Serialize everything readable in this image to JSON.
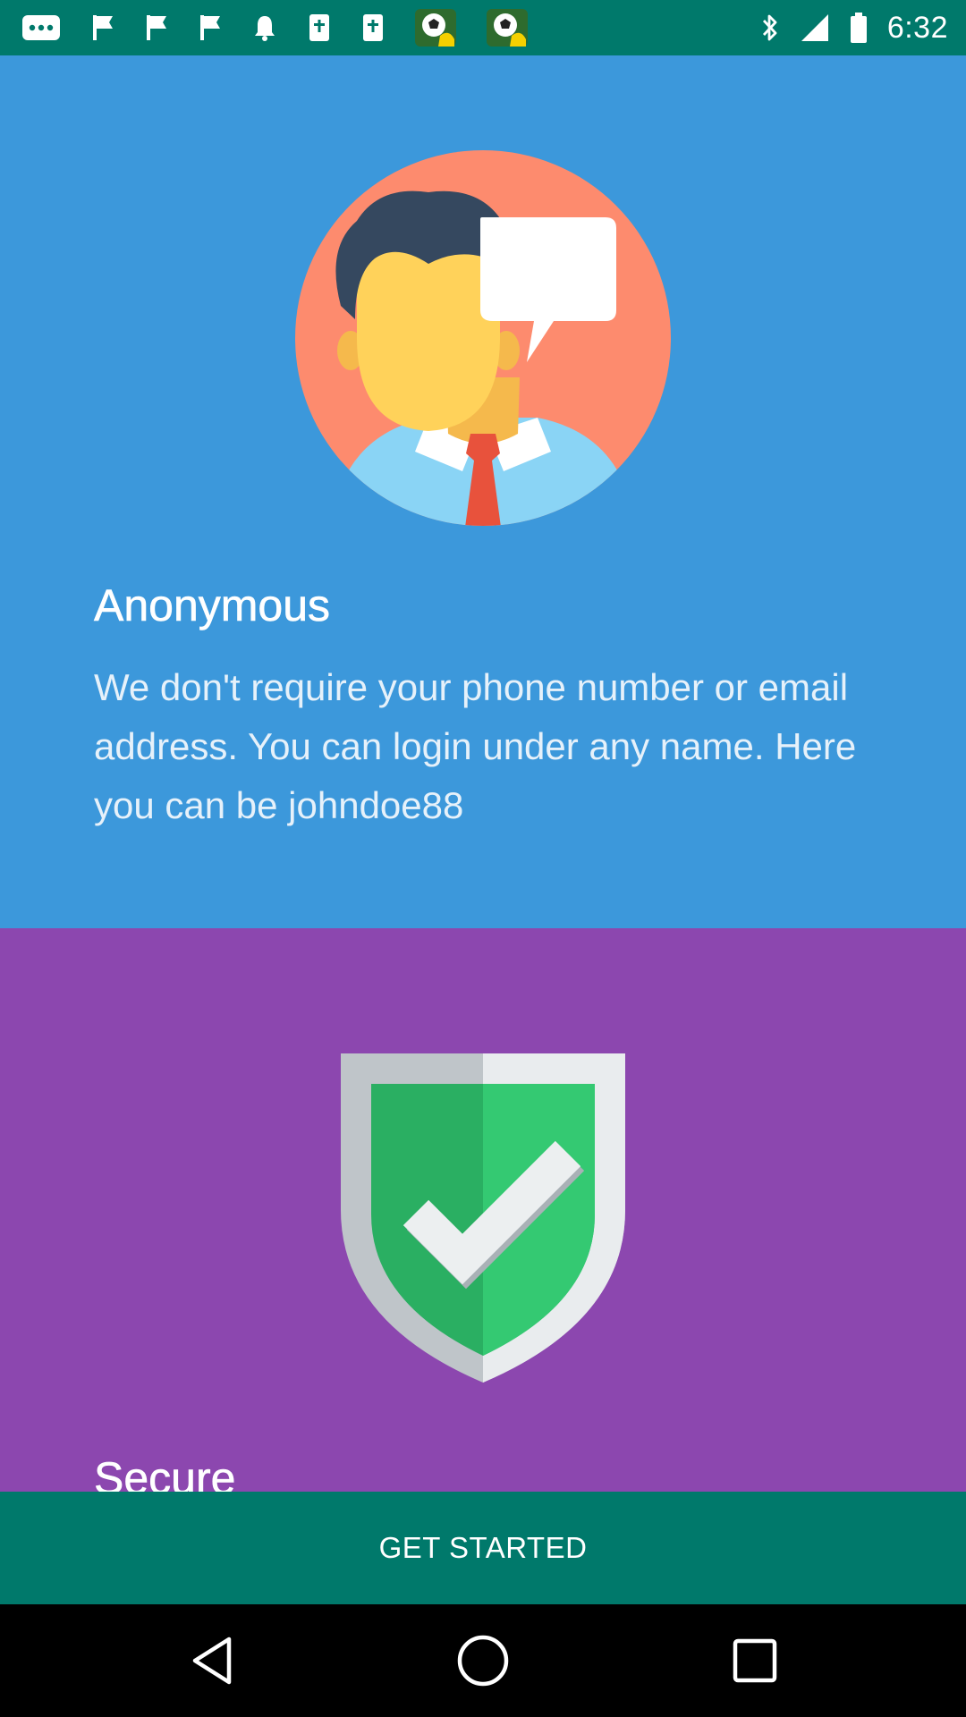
{
  "status_bar": {
    "time": "6:32",
    "left_icons": [
      "more-horiz-icon",
      "flag-icon",
      "flag-icon",
      "flag-icon",
      "bell-icon",
      "cross-book-icon",
      "cross-book-icon",
      "soccer-ball-icon",
      "soccer-ball-icon"
    ],
    "right_icons": [
      "bluetooth-icon",
      "signal-icon",
      "battery-icon"
    ]
  },
  "cards": {
    "anonymous": {
      "title": "Anonymous",
      "text": "We don't require your phone number or email address. You can login under any name. Here you can be johndoe88",
      "background": "#3c98db"
    },
    "secure": {
      "title": "Secure",
      "background": "#8c47af"
    }
  },
  "action": {
    "label": "GET STARTED",
    "background": "#00796b"
  },
  "nav_bar": {
    "icons": [
      "back-icon",
      "home-icon",
      "recents-icon"
    ]
  }
}
